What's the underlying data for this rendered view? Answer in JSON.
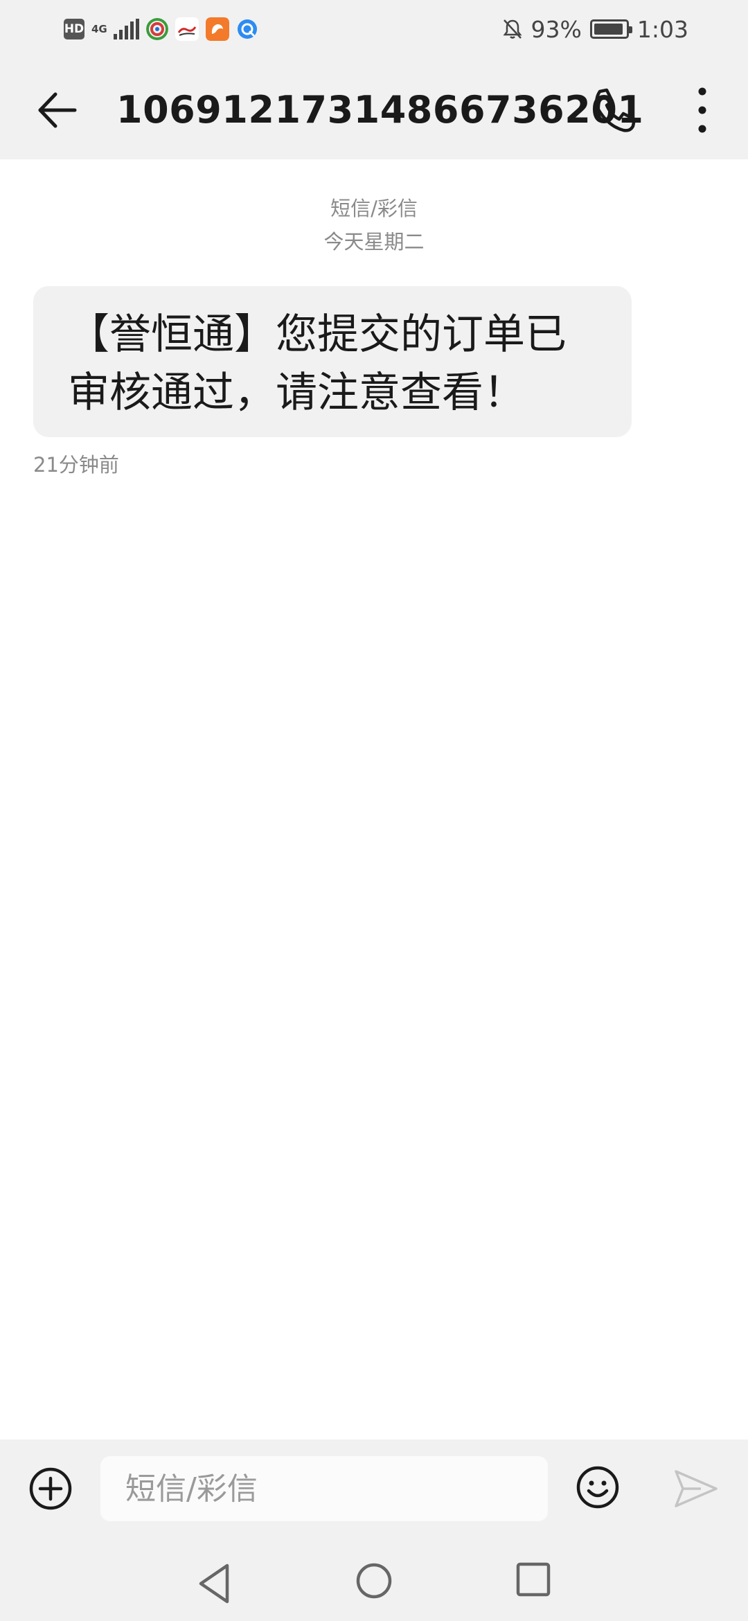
{
  "status_bar": {
    "network_badge": "HD",
    "network_type": "4G",
    "battery": "93%",
    "time": "1:03",
    "icons": [
      "hd-icon",
      "4g-icon",
      "signal-icon",
      "app-icon-circle",
      "sina-icon",
      "uc-browser-icon",
      "browser-icon",
      "bell-off-icon",
      "battery-icon"
    ]
  },
  "header": {
    "title": "10691217314866736201",
    "icons": [
      "back-arrow-icon",
      "phone-icon",
      "more-vertical-icon"
    ]
  },
  "conversation": {
    "channel_label": "短信/彩信",
    "date_label": "今天星期二",
    "messages": [
      {
        "text": "【誉恒通】您提交的订单已审核通过，请注意查看！",
        "time": "21分钟前"
      }
    ]
  },
  "composer": {
    "placeholder": "短信/彩信",
    "value": "",
    "icons": [
      "add-circle-icon",
      "emoji-icon",
      "send-icon"
    ]
  },
  "nav_bar": {
    "icons": [
      "nav-back-icon",
      "nav-home-icon",
      "nav-recents-icon"
    ]
  },
  "colors": {
    "bar_background": "#f1f1f1",
    "bubble_background": "#f1f1f1",
    "text_primary": "#1a1a1a",
    "text_secondary": "#8a8a8a"
  }
}
